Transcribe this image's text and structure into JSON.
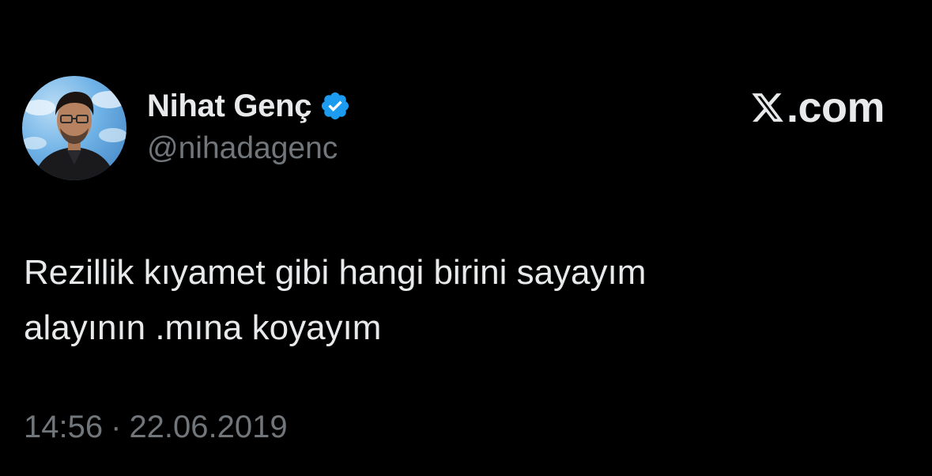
{
  "author": {
    "display_name": "Nihat Genç",
    "handle": "@nihadagenc",
    "verified_icon": "verified-badge-icon",
    "verified_color": "#1d9bf0"
  },
  "brand": {
    "icon": "x-logo-icon",
    "text": ".com"
  },
  "tweet": {
    "text": "Rezillik kıyamet gibi hangi birini sayayım\nalayının .mına koyayım",
    "time": "14:56",
    "separator": "·",
    "date": "22.06.2019"
  },
  "colors": {
    "background": "#000000",
    "primary_text": "#e7e9ea",
    "secondary_text": "#71767b"
  }
}
